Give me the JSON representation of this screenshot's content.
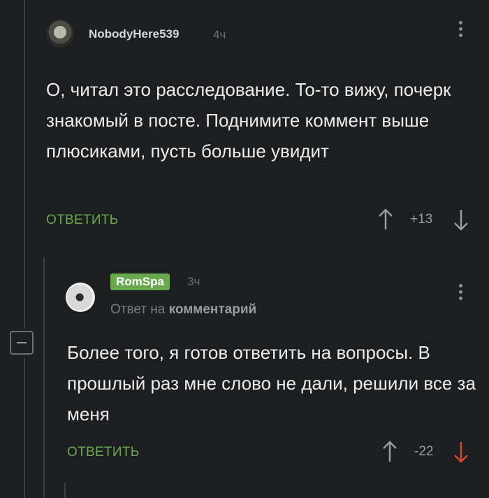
{
  "comment1": {
    "username": "NobodyHere539",
    "time": "4ч",
    "text": "О, читал это расследование. То-то вижу, почерк знакомый в посте. Поднимите коммент выше плюсиками, пусть больше увидит",
    "reply_label": "ОТВЕТИТЬ",
    "rating": "+13"
  },
  "comment2": {
    "username": "RomSpa",
    "time": "3ч",
    "reply_to_prefix": "Ответ на",
    "reply_to_target": "комментарий",
    "text": "Более того, я готов ответить на вопросы. В прошлый раз мне слово не дали, решили все за меня",
    "reply_label": "ОТВЕТИТЬ",
    "rating": "-22"
  },
  "colors": {
    "background": "#1d1e20",
    "accent_green": "#6aa84f",
    "downvote_active": "#d9482b",
    "muted": "#8e8f92"
  },
  "icons": [
    "avatar",
    "more-vertical-icon",
    "upvote-arrow-icon",
    "downvote-arrow-icon",
    "collapse-minus-icon"
  ]
}
